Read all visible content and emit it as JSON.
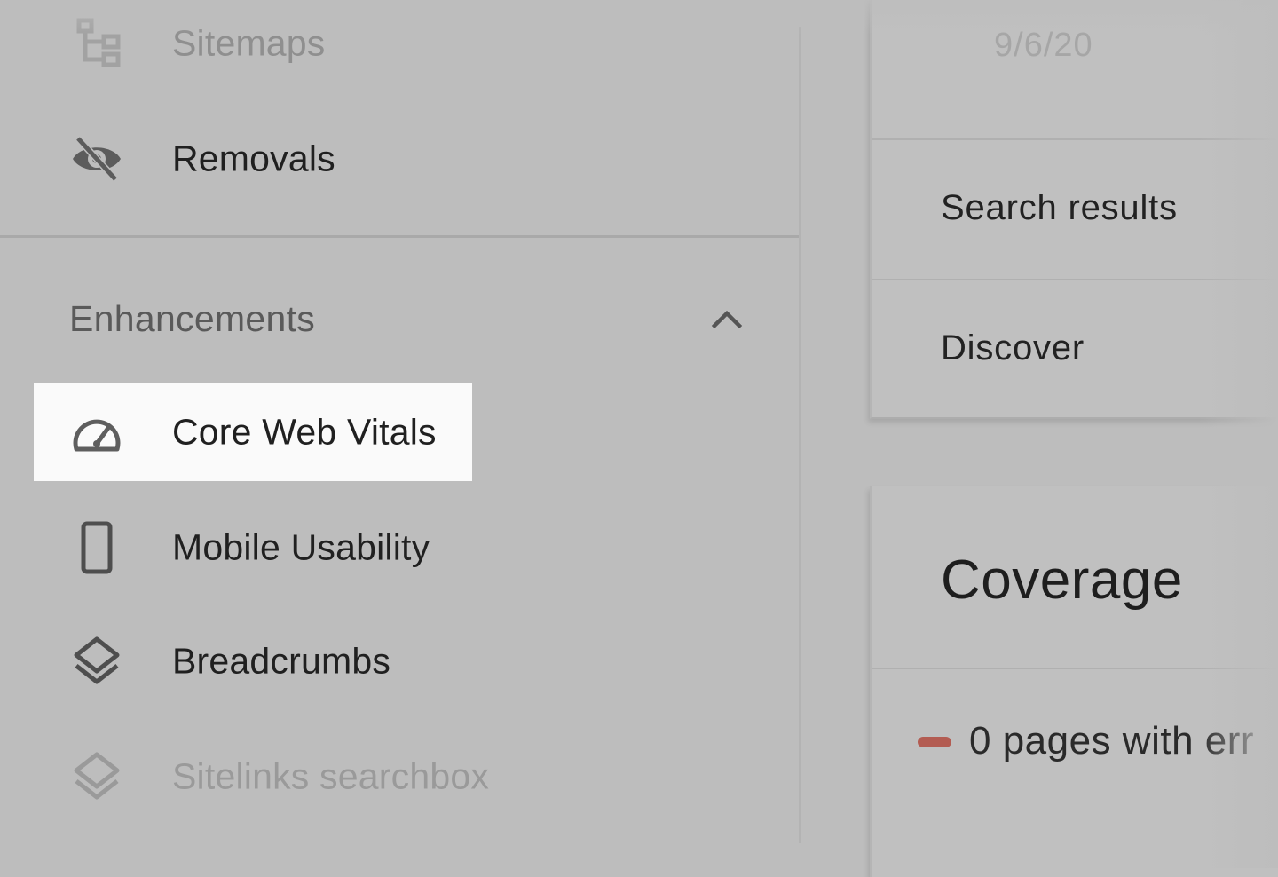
{
  "sidebar": {
    "items_top": [
      {
        "label": "Sitemaps",
        "icon": "sitemap-icon"
      },
      {
        "label": "Removals",
        "icon": "eye-off-icon"
      }
    ],
    "section": {
      "title": "Enhancements",
      "collapse_icon": "chevron-up-icon",
      "items": [
        {
          "label": "Core Web Vitals",
          "icon": "speedometer-icon",
          "selected": true
        },
        {
          "label": "Mobile Usability",
          "icon": "smartphone-icon"
        },
        {
          "label": "Breadcrumbs",
          "icon": "layers-icon"
        },
        {
          "label": "Sitelinks searchbox",
          "icon": "layers-icon"
        }
      ]
    }
  },
  "main": {
    "performance_card": {
      "date": "9/6/20",
      "rows": [
        "Search results",
        "Discover"
      ]
    },
    "coverage_card": {
      "title": "Coverage",
      "legend": [
        {
          "text": "0 pages with err",
          "color": "#b35c52"
        }
      ]
    }
  },
  "colors": {
    "background": "#bdbdbd",
    "selected_background": "#fafafa",
    "error": "#b35c52"
  }
}
